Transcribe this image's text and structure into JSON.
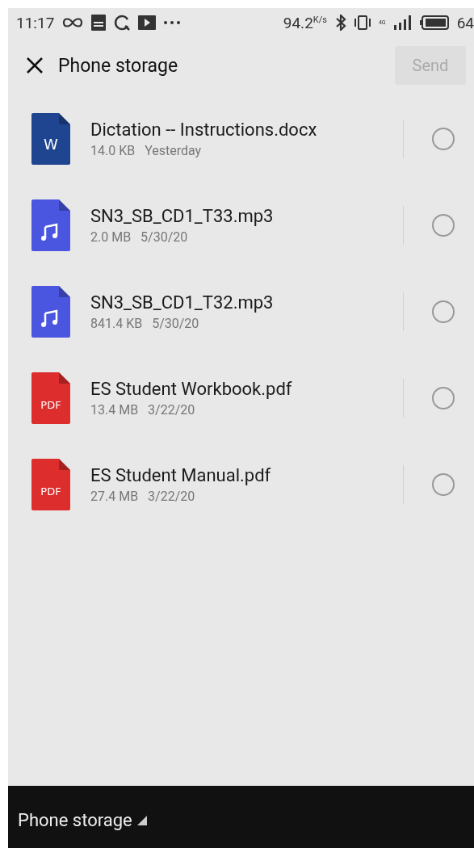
{
  "status_bar": {
    "time": "11:17",
    "speed": "94.2",
    "speed_unit": "K/s",
    "network": "4G",
    "battery": "64"
  },
  "header": {
    "title": "Phone storage",
    "send": {
      "label": "Send",
      "disabled": true
    }
  },
  "files": [
    {
      "kind": "docx",
      "badge": "W",
      "name": "Dictation -- Instructions.docx",
      "size": "14.0 KB",
      "date": "Yesterday",
      "selected": false
    },
    {
      "kind": "audio",
      "name": "SN3_SB_CD1_T33.mp3",
      "size": "2.0 MB",
      "date": "5/30/20",
      "selected": false
    },
    {
      "kind": "audio",
      "name": "SN3_SB_CD1_T32.mp3",
      "size": "841.4 KB",
      "date": "5/30/20",
      "selected": false
    },
    {
      "kind": "pdf",
      "badge": "PDF",
      "name": "ES Student Workbook.pdf",
      "size": "13.4 MB",
      "date": "3/22/20",
      "selected": false
    },
    {
      "kind": "pdf",
      "badge": "PDF",
      "name": "ES Student Manual.pdf",
      "size": "27.4 MB",
      "date": "3/22/20",
      "selected": false
    }
  ],
  "bottom_bar": {
    "location": "Phone storage"
  }
}
